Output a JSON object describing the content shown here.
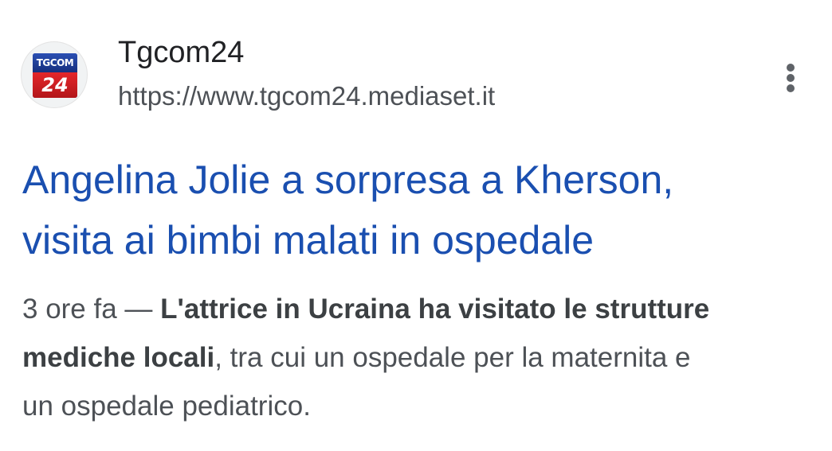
{
  "source": {
    "logo_top": "TGCOM",
    "logo_bottom": "24",
    "name": "Tgcom24",
    "url": "https://www.tgcom24.mediaset.it"
  },
  "more_menu": {
    "icon": "more-vert-icon"
  },
  "result": {
    "title_line1": "Angelina Jolie a sorpresa a Kherson,",
    "title_line2": "visita ai bimbi malati in ospedale",
    "time": "3 ore fa",
    "separator": " — ",
    "snippet_bold_1": "L'attrice in Ucraina ha visitato le strutture",
    "snippet_bold_2": "mediche locali",
    "snippet_rest_1": ", tra cui un ospedale per la maternita e",
    "snippet_rest_2": "un ospedale pediatrico."
  },
  "colors": {
    "title": "#1a4fb0",
    "text": "#4d5156",
    "site_name": "#202124",
    "logo_blue": "#1d3f9a",
    "logo_red": "#d71f23"
  }
}
